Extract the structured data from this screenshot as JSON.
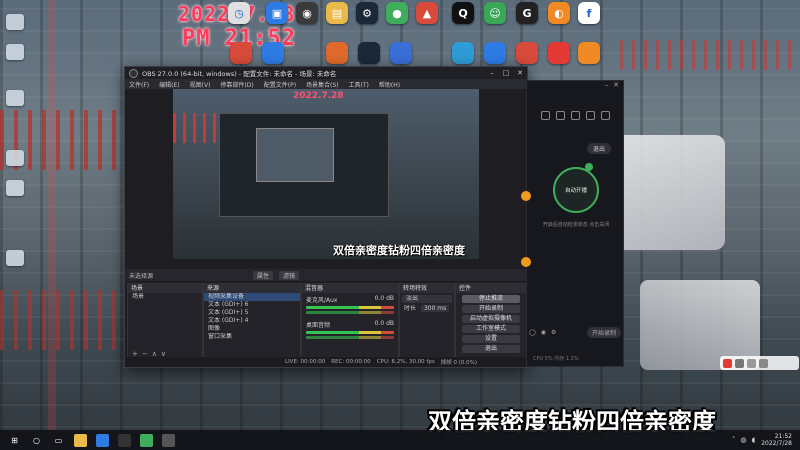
{
  "overlay": {
    "date": "2022.7.28",
    "time": "PM 21:52"
  },
  "desktop_icons": [
    {
      "name": "clock-app-icon",
      "color": "#e0e0e0",
      "glyph": "◷"
    },
    {
      "name": "photo-app-icon",
      "color": "#2e7be4",
      "glyph": "▣"
    },
    {
      "name": "camera-app-icon",
      "color": "#3a3a3a",
      "glyph": "◉"
    },
    {
      "name": "folder-icon",
      "color": "#e9b949",
      "glyph": "▤"
    },
    {
      "name": "steam-icon",
      "color": "#1b2838",
      "glyph": "⚙"
    },
    {
      "name": "recorder-app-icon",
      "color": "#3fae5c",
      "glyph": "●"
    },
    {
      "name": "game-app-icon",
      "color": "#d84b3a",
      "glyph": "▲"
    },
    {
      "name": "qq-icon",
      "color": "#111111",
      "glyph": "Q"
    },
    {
      "name": "chat-app-icon",
      "color": "#3aa757",
      "glyph": "☺"
    },
    {
      "name": "g-app-icon",
      "color": "#222222",
      "glyph": "G"
    },
    {
      "name": "orange-app-icon",
      "color": "#f08a24",
      "glyph": "◐"
    },
    {
      "name": "browser-icon",
      "color": "#ffffff",
      "glyph": "f"
    }
  ],
  "obs": {
    "title": "OBS 27.0.0 (64-bit, windows) - 配置文件: 未命名 - 场景: 未命名",
    "menu": [
      "文件(F)",
      "编辑(E)",
      "视图(V)",
      "停靠部件(D)",
      "配置文件(P)",
      "场景集合(S)",
      "工具(T)",
      "帮助(H)"
    ],
    "no_source": "未选择源",
    "toolbar_buttons": [
      "属性",
      "滤镜"
    ],
    "preview_subtitle": "双倍亲密度钻粉四倍亲密度",
    "scenes": {
      "header": "场景",
      "items": [
        "场景"
      ]
    },
    "sources": {
      "header": "来源",
      "items": [
        "视频采集设备",
        "文本 (GDI+) 6",
        "文本 (GDI+) 5",
        "文本 (GDI+) 4",
        "图像",
        "窗口采集"
      ]
    },
    "mixer": {
      "header": "混音器",
      "channels": [
        {
          "name": "麦克风/Aux",
          "db": "0.0 dB"
        },
        {
          "name": "桌面音频",
          "db": "0.0 dB"
        }
      ]
    },
    "transitions": {
      "header": "转场特效",
      "type": "淡出",
      "duration_label": "时长",
      "duration": "300 ms"
    },
    "controls": {
      "header": "控件",
      "buttons": [
        "停止推流",
        "开始录制",
        "启动虚拟摄像机",
        "工作室模式",
        "设置",
        "退出"
      ]
    },
    "status": {
      "live": "LIVE: 00:00:00",
      "rec": "REC: 00:00:00",
      "cpu": "CPU: 6.2%, 30.00 fps",
      "dropped": "掉帧 0 (0.0%)"
    }
  },
  "recorder": {
    "exit_label": "退出",
    "circle_label": "自动开播",
    "note": "开启后自动检测状态 点击关闭",
    "pill": "开始录制",
    "stats": "CPU 5%  内存 1.2%"
  },
  "subtitle": "双倍亲密度钻粉四倍亲密度",
  "taskbar": {
    "clock_time": "21:52",
    "clock_date": "2022/7/28"
  }
}
